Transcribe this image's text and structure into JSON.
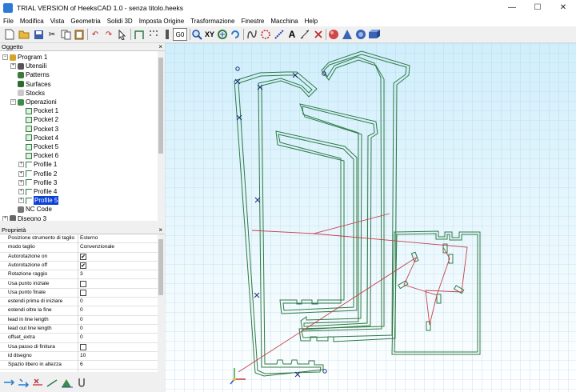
{
  "window": {
    "title": "TRIAL VERSION of HeeksCAD 1.0 - senza titolo.heeks"
  },
  "menu": [
    "File",
    "Modifica",
    "Vista",
    "Geometria",
    "Solidi 3D",
    "Imposta Origine",
    "Trasformazione",
    "Finestre",
    "Macchina",
    "Help"
  ],
  "toolbar": {
    "g0_label": "G0",
    "xy_label": "XY",
    "text_label": "A"
  },
  "objects_panel": {
    "title": "Oggetto",
    "close": "×",
    "tree": [
      {
        "label": "Program 1",
        "level": 0,
        "expander": "−",
        "icon": "program-icon",
        "selected": false
      },
      {
        "label": "Utensili",
        "level": 1,
        "expander": "+",
        "icon": "tools-icon",
        "selected": false
      },
      {
        "label": "Patterns",
        "level": 1,
        "expander": "",
        "icon": "patterns-icon",
        "selected": false
      },
      {
        "label": "Surfaces",
        "level": 1,
        "expander": "",
        "icon": "surfaces-icon",
        "selected": false
      },
      {
        "label": "Stocks",
        "level": 1,
        "expander": "",
        "icon": "stocks-icon",
        "selected": false
      },
      {
        "label": "Operazioni",
        "level": 1,
        "expander": "−",
        "icon": "operations-icon",
        "selected": false
      },
      {
        "label": "Pocket 1",
        "level": 2,
        "expander": "",
        "icon": "pocket-icon",
        "selected": false
      },
      {
        "label": "Pocket 2",
        "level": 2,
        "expander": "",
        "icon": "pocket-icon",
        "selected": false
      },
      {
        "label": "Pocket 3",
        "level": 2,
        "expander": "",
        "icon": "pocket-icon",
        "selected": false
      },
      {
        "label": "Pocket 4",
        "level": 2,
        "expander": "",
        "icon": "pocket-icon",
        "selected": false
      },
      {
        "label": "Pocket 5",
        "level": 2,
        "expander": "",
        "icon": "pocket-icon",
        "selected": false
      },
      {
        "label": "Pocket 6",
        "level": 2,
        "expander": "",
        "icon": "pocket-icon",
        "selected": false
      },
      {
        "label": "Profile 1",
        "level": 2,
        "expander": "+",
        "icon": "profile-icon",
        "selected": false
      },
      {
        "label": "Profile 2",
        "level": 2,
        "expander": "+",
        "icon": "profile-icon",
        "selected": false
      },
      {
        "label": "Profile 3",
        "level": 2,
        "expander": "+",
        "icon": "profile-icon",
        "selected": false
      },
      {
        "label": "Profile 4",
        "level": 2,
        "expander": "+",
        "icon": "profile-icon",
        "selected": false
      },
      {
        "label": "Profile 5",
        "level": 2,
        "expander": "+",
        "icon": "profile-icon",
        "selected": true
      },
      {
        "label": "NC Code",
        "level": 1,
        "expander": "",
        "icon": "nc-code-icon",
        "selected": false
      },
      {
        "label": "Disegno 3",
        "level": 0,
        "expander": "+",
        "icon": "drawing-icon",
        "selected": false
      }
    ]
  },
  "properties_panel": {
    "title": "Proprietà",
    "close": "×",
    "rows": [
      {
        "name": "Posizione strumento di taglio",
        "value": "Esterno",
        "checkbox": false
      },
      {
        "name": "modo taglio",
        "value": "Convenzionale",
        "checkbox": false
      },
      {
        "name": "Autorotazione on",
        "value": "",
        "checkbox": true,
        "checked": true
      },
      {
        "name": "Autorotazione off",
        "value": "",
        "checkbox": true,
        "checked": true
      },
      {
        "name": "Rotazione raggio",
        "value": "3",
        "checkbox": false
      },
      {
        "name": "Usa punto iniziale",
        "value": "",
        "checkbox": true,
        "checked": false
      },
      {
        "name": "Usa punto finale",
        "value": "",
        "checkbox": true,
        "checked": false
      },
      {
        "name": "estendi prima di iniziare",
        "value": "0",
        "checkbox": false
      },
      {
        "name": "estendi oltre la fine",
        "value": "0",
        "checkbox": false
      },
      {
        "name": "lead in line length",
        "value": "0",
        "checkbox": false
      },
      {
        "name": "lead out line length",
        "value": "0",
        "checkbox": false
      },
      {
        "name": "offset_extra",
        "value": "0",
        "checkbox": false
      },
      {
        "name": "Usa passo di finitura",
        "value": "",
        "checkbox": true,
        "checked": false
      },
      {
        "name": "id disegno",
        "value": "10",
        "checkbox": false
      },
      {
        "name": "Spazio libero in altezza",
        "value": "6",
        "checkbox": false
      }
    ]
  },
  "colors": {
    "canvas_top": "#cfeefb",
    "canvas_bottom": "#ffffff",
    "grid": "#a9cfe0",
    "profile_green": "#2f7a46",
    "toolpath_red": "#c4404a",
    "selection_blue": "#0a3fd8"
  }
}
